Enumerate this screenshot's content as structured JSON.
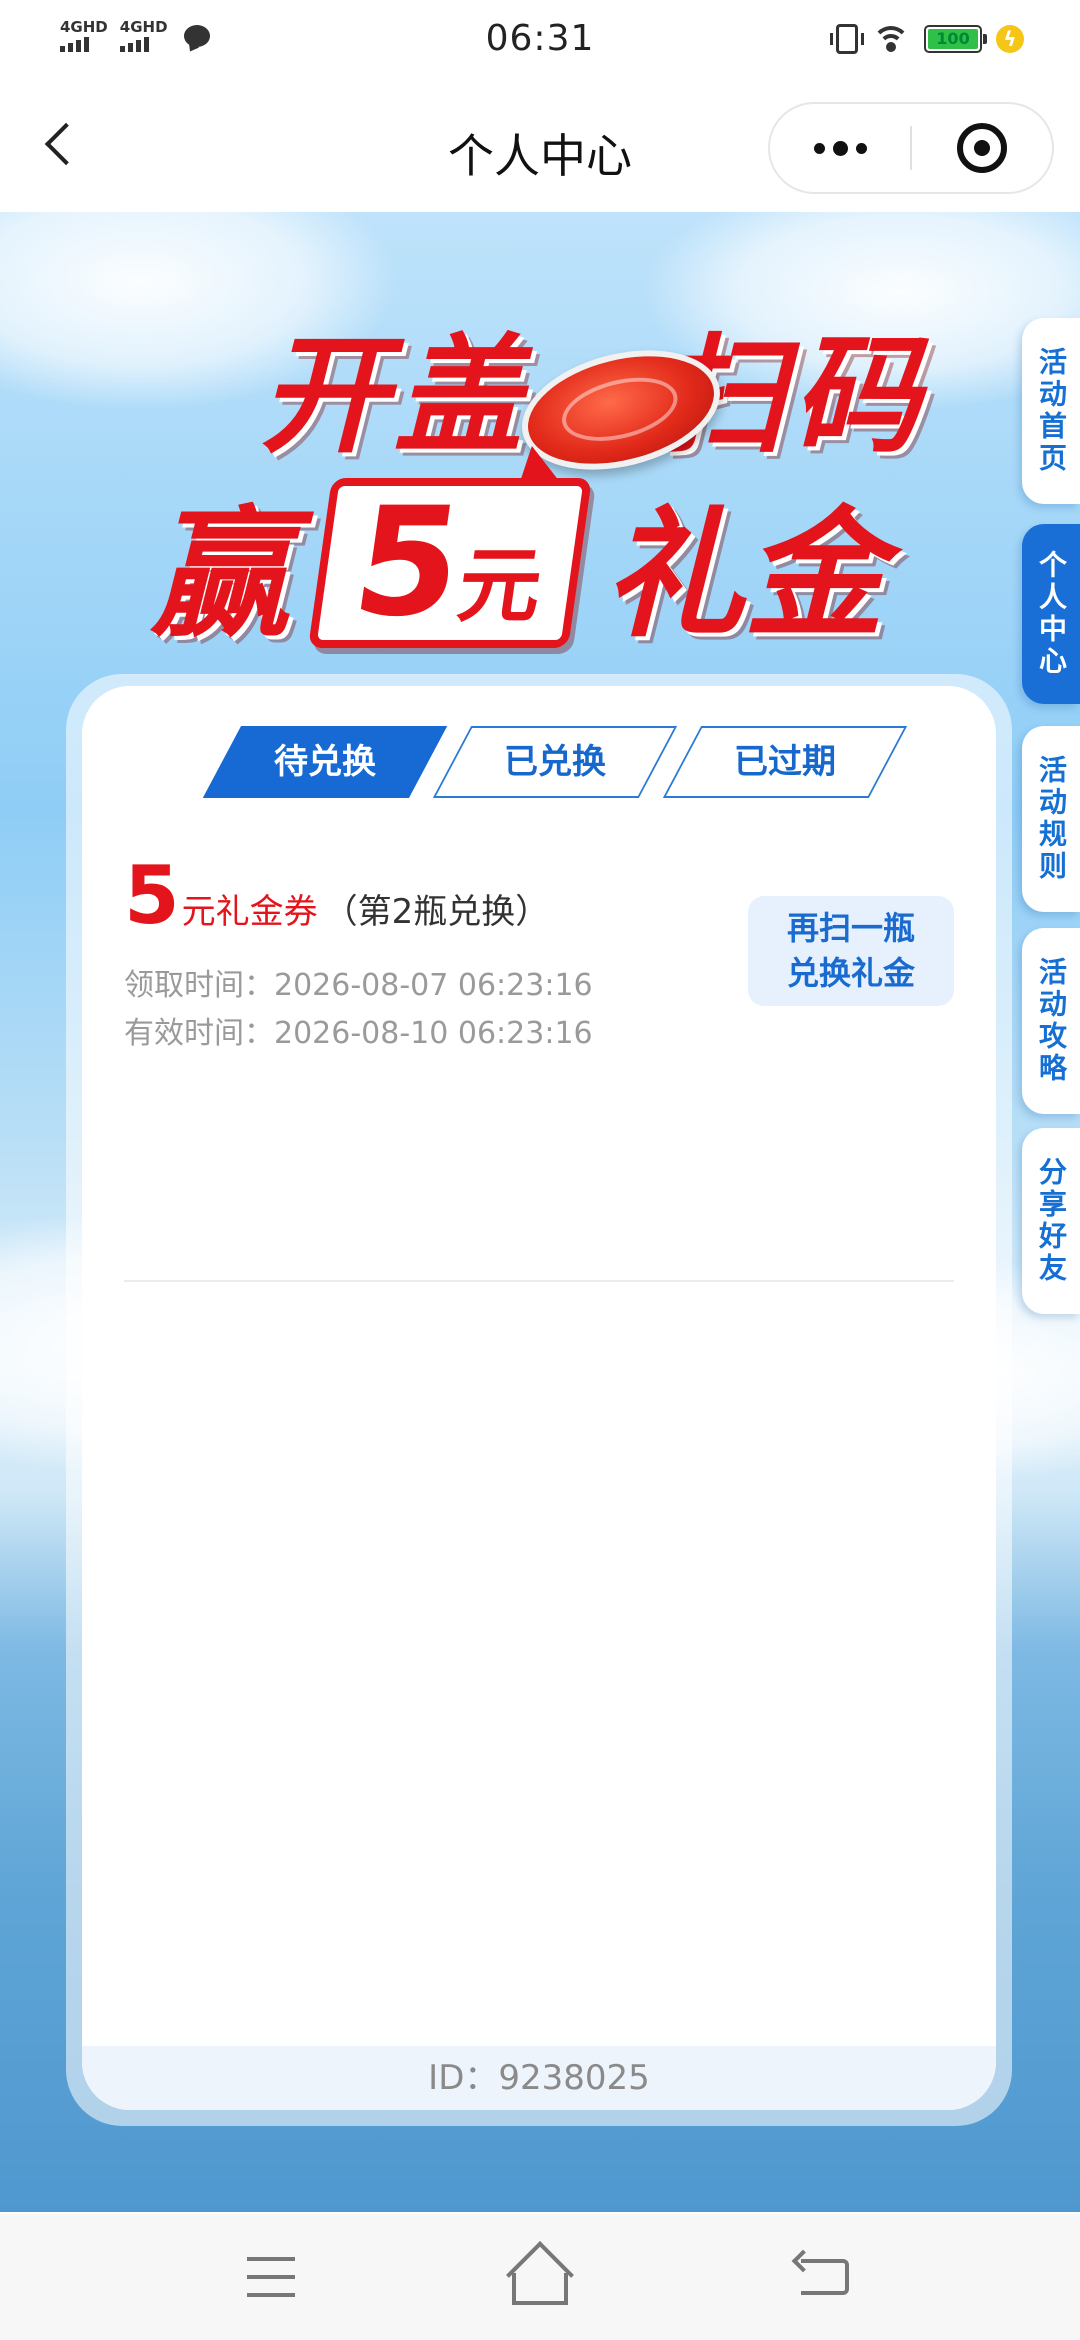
{
  "status_bar": {
    "time": "06:31",
    "net1": "4GHD",
    "net2": "4GHD",
    "battery": "100",
    "chat_icon": "chat-bubble-icon",
    "vibrate_icon": "vibrate-icon",
    "wifi_icon": "wifi-icon",
    "charging_icon": "charging-icon"
  },
  "header": {
    "title": "个人中心",
    "back_icon": "chevron-left-icon",
    "more_icon": "more-dots-icon",
    "close_icon": "target-close-icon"
  },
  "banner": {
    "line1_left": "开盖",
    "line1_right": "扫码",
    "win": "赢",
    "prize_number": "5",
    "prize_unit": "元",
    "gift": "礼金"
  },
  "side_tabs": [
    {
      "label": "活动首页",
      "active": false
    },
    {
      "label": "个人中心",
      "active": true
    },
    {
      "label": "活动规则",
      "active": false
    },
    {
      "label": "活动攻略",
      "active": false
    },
    {
      "label": "分享好友",
      "active": false
    }
  ],
  "tabs": [
    {
      "label": "待兑换",
      "active": true
    },
    {
      "label": "已兑换",
      "active": false
    },
    {
      "label": "已过期",
      "active": false
    }
  ],
  "coupon": {
    "amount": "5",
    "unit_label": "元礼金券",
    "note": "（第2瓶兑换）",
    "receive_label": "领取时间：",
    "receive_time": "2026-08-07 06:23:16",
    "valid_label": "有效时间：",
    "valid_time": "2026-08-10 06:23:16",
    "button_line1": "再扫一瓶",
    "button_line2": "兑换礼金"
  },
  "footer": {
    "id_text": "ID：9238025"
  },
  "nav": {
    "menu_icon": "menu-icon",
    "home_icon": "home-icon",
    "back_icon": "back-icon"
  }
}
